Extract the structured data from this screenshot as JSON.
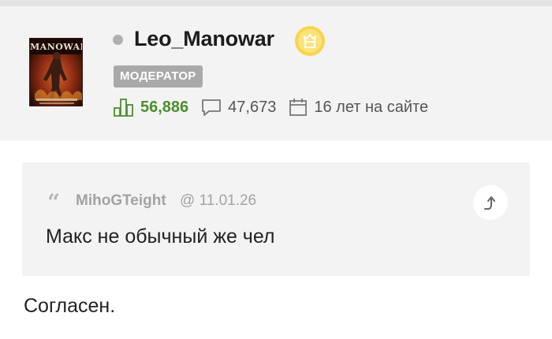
{
  "profile": {
    "username": "Leo_Manowar",
    "role": "МОДЕРАТОР",
    "avatar_text": "MANOWAR",
    "status": "offline",
    "badge_icon": "crown-award-icon",
    "stats": {
      "rating": "56,886",
      "comments": "47,673",
      "tenure": "16 лет на сайте"
    },
    "colors": {
      "rating": "#4d8e2c",
      "badge": "#f5c518",
      "role_badge": "#a9a9a9"
    }
  },
  "quote": {
    "author": "MihoGTeight",
    "date": "@ 11.01.26",
    "text": "Макс не обычный же чел",
    "goto_icon": "arrow-goto-icon"
  },
  "reply": {
    "text": "Согласен."
  }
}
